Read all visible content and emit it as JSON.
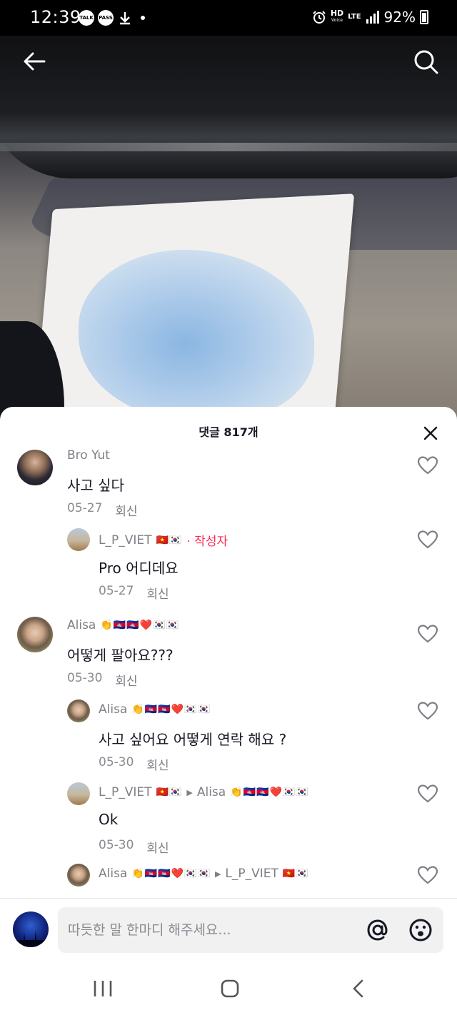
{
  "status_bar": {
    "time": "12:39",
    "notif_icons": [
      "TALK",
      "PASS"
    ],
    "network": "HD",
    "network_sub": "Voice",
    "lte": "LTE",
    "battery": "92%"
  },
  "video": {
    "back_icon": "arrow-left-icon",
    "search_icon": "search-icon"
  },
  "comments_sheet": {
    "title": "댓글 817개",
    "comments": [
      {
        "level": "top",
        "username": "Bro Yut",
        "flags": "",
        "text": "사고 싶다",
        "date": "05-27",
        "reply_label": "회신"
      },
      {
        "level": "reply",
        "username": "L_P_VIET",
        "flags": "🇻🇳🇰🇷",
        "author_label": "· 작성자",
        "text": "Pro 어디데요",
        "date": "05-27",
        "reply_label": "회신"
      },
      {
        "level": "top",
        "username": "Alisa",
        "flags": "👏🇰🇭🇰🇭❤️🇰🇷🇰🇷",
        "text": "어떻게 팔아요???",
        "date": "05-30",
        "reply_label": "회신"
      },
      {
        "level": "reply",
        "username": "Alisa",
        "flags": "👏🇰🇭🇰🇭❤️🇰🇷🇰🇷",
        "text": "사고 싶어요 어떻게 연락 해요 ?",
        "date": "05-30",
        "reply_label": "회신"
      },
      {
        "level": "reply",
        "username": "L_P_VIET",
        "flags": "🇻🇳🇰🇷",
        "reply_to": "Alisa",
        "reply_to_flags": "👏🇰🇭🇰🇭❤️🇰🇷🇰🇷",
        "text": "Ok",
        "date": "05-30",
        "reply_label": "회신"
      },
      {
        "level": "reply",
        "username": "Alisa",
        "flags": "👏🇰🇭🇰🇭❤️🇰🇷🇰🇷",
        "reply_to": "L_P_VIET",
        "reply_to_flags": "🇻🇳🇰🇷"
      }
    ]
  },
  "input_bar": {
    "placeholder": "따듯한 말 한마디 해주세요...",
    "mention_icon": "at-icon",
    "emoji_icon": "emoji-icon"
  },
  "nav_bar": {
    "recents_icon": "recents-icon",
    "home_icon": "home-icon",
    "back_icon": "back-icon"
  }
}
